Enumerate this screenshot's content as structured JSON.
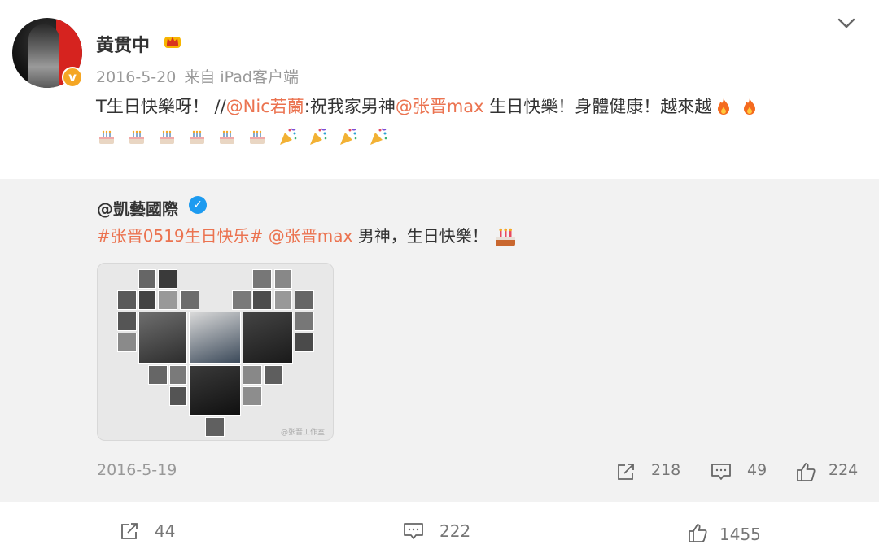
{
  "post": {
    "username": "黄贯中",
    "date": "2016-5-20",
    "source": "来自 iPad客户端",
    "text_prefix": "T生日快樂呀！ //",
    "mention1": "@Nic若蘭",
    "text_mid": ":祝我家男神",
    "mention2": "@张晋max",
    "text_suffix": " 生日快樂！身體健康！越來越"
  },
  "retweet": {
    "user": "@凱藝國際",
    "hashtag": "#张晋0519生日快乐#",
    "mention": " @张晋max",
    "text": " 男神，生日快樂！",
    "watermark": "@张晋工作室",
    "date": "2016-5-19",
    "reposts": "218",
    "comments": "49",
    "likes": "224"
  },
  "actions": {
    "reposts": "44",
    "comments": "222",
    "likes": "1455"
  },
  "colors": {
    "link": "#eb7350",
    "verified_gold": "#f5a623",
    "verified_blue": "#1d9bf0",
    "retweet_bg": "#f2f2f2"
  },
  "icons": [
    "crown-icon",
    "chevron-down-icon",
    "fire-icon",
    "cake-icon",
    "party-popper-icon",
    "verified-icon",
    "repost-icon",
    "comment-icon",
    "like-icon"
  ]
}
